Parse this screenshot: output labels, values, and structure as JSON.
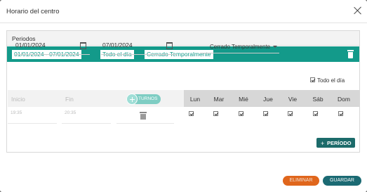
{
  "modal": {
    "title": "Horario del centro"
  },
  "periods": {
    "title": "Periodos",
    "active_period": {
      "date_range": "01/01/2024 - 07/01/2024",
      "all_day_tag": "Todo el día",
      "status_tag": "Cerrado Temporalmente"
    },
    "start_date": "01/01/2024",
    "end_date": "07/01/2024",
    "status_select": {
      "selected": "Cerrado Temporalmente"
    },
    "all_day": {
      "label": "Todo el día",
      "checked": true
    },
    "table": {
      "col_start": "Inicio",
      "col_end": "Fin",
      "turnos_button": "TURNOS",
      "days": [
        "Lun",
        "Mar",
        "Mié",
        "Jue",
        "Vie",
        "Sáb",
        "Dom"
      ],
      "rows": [
        {
          "start": "19:35",
          "end": "20:35",
          "days_checked": [
            true,
            true,
            true,
            true,
            true,
            true,
            true
          ]
        }
      ]
    },
    "add_period_button": "PERÍODO"
  },
  "footer": {
    "delete_button": "ELIMINAR",
    "save_button": "GUARDAR"
  },
  "colors": {
    "teal": "#139a8a",
    "dark_teal": "#1c6b6a",
    "delete_orange": "#e0661c",
    "save_teal": "#1b6a73"
  }
}
